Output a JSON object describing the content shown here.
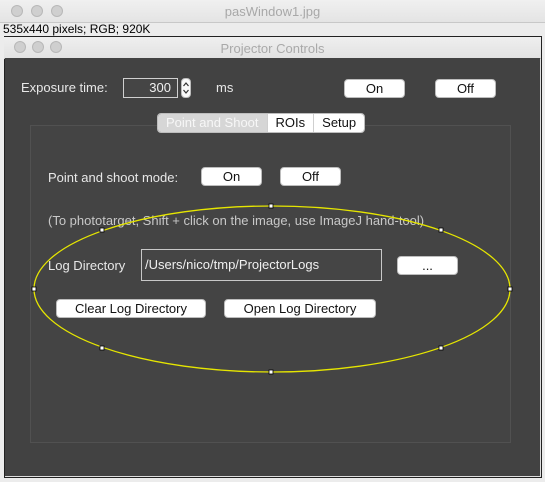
{
  "outer_window": {
    "title": "pasWindow1.jpg",
    "info": "535x440 pixels; RGB; 920K"
  },
  "panel_window": {
    "title": "Projector Controls"
  },
  "exposure": {
    "label": "Exposure time:",
    "value": "300",
    "unit": "ms",
    "on_label": "On",
    "off_label": "Off"
  },
  "tabs": [
    {
      "label": "Point and Shoot",
      "selected": true
    },
    {
      "label": "ROIs",
      "selected": false
    },
    {
      "label": "Setup",
      "selected": false
    }
  ],
  "point_and_shoot": {
    "mode_label": "Point and shoot mode:",
    "on_label": "On",
    "off_label": "Off",
    "hint": "(To phototarget, Shift + click on the image, use ImageJ hand-tool)",
    "log_dir_label": "Log Directory",
    "log_dir_value": "/Users/nico/tmp/ProjectorLogs",
    "browse_label": "...",
    "clear_label": "Clear Log Directory",
    "open_label": "Open Log Directory"
  },
  "colors": {
    "panel_bg": "#424242",
    "roi_stroke": "#e6e600"
  }
}
